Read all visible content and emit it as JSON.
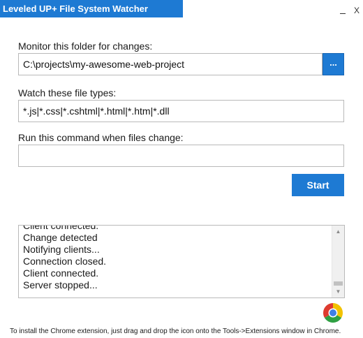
{
  "window": {
    "title": "Leveled UP+ File System Watcher",
    "minimize": "_",
    "close": "X"
  },
  "folder": {
    "label": "Monitor this folder for changes:",
    "value": "C:\\projects\\my-awesome-web-project",
    "browse_label": "..."
  },
  "filetypes": {
    "label": "Watch these file types:",
    "value": "*.js|*.css|*.cshtml|*.html|*.htm|*.dll"
  },
  "command": {
    "label": "Run this command when files change:",
    "value": ""
  },
  "start_label": "Start",
  "log": {
    "lines": [
      "Client connected.",
      "Change detected",
      "Notifying clients...",
      "Connection closed.",
      "Client connected.",
      "Server stopped..."
    ]
  },
  "footer": {
    "hint": "To install the Chrome extension, just drag and drop the icon onto the Tools->Extensions window in Chrome.",
    "icon": "chrome-icon"
  },
  "colors": {
    "accent": "#1e7ad3",
    "border": "#b9b9b9"
  }
}
